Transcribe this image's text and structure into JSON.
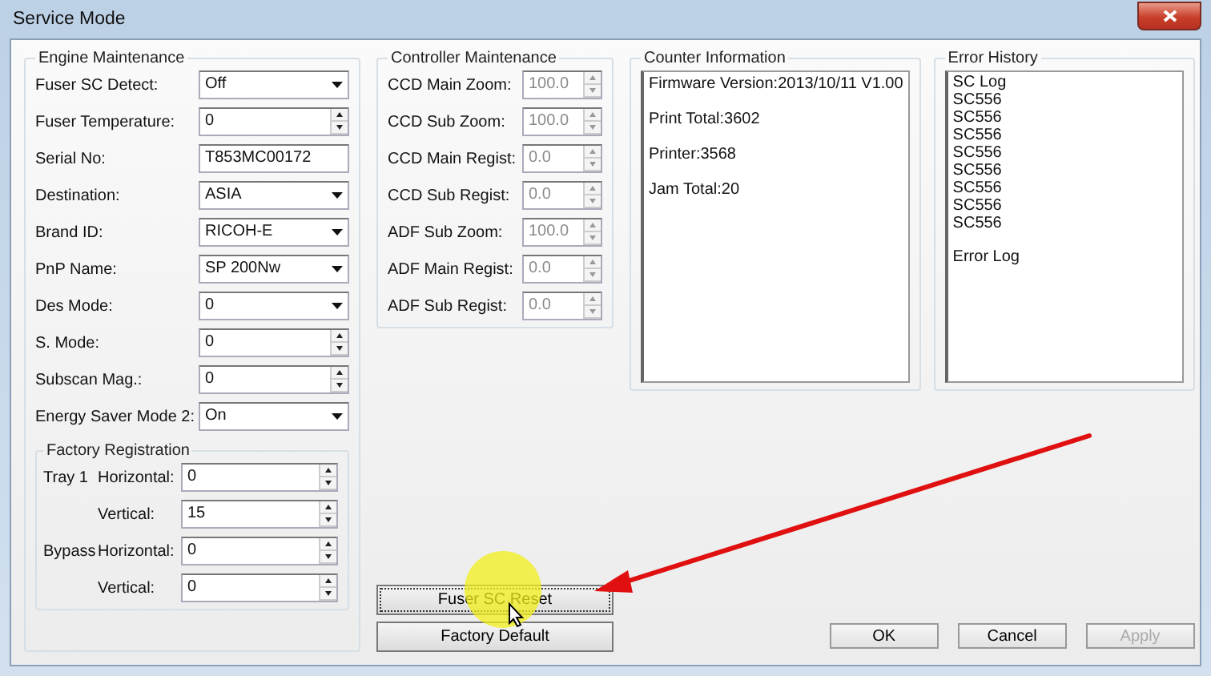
{
  "window": {
    "title": "Service Mode"
  },
  "engine_maintenance": {
    "title": "Engine Maintenance",
    "fields": [
      {
        "label": "Fuser SC Detect:",
        "value": "Off",
        "kind": "dropdown"
      },
      {
        "label": "Fuser Temperature:",
        "value": "0",
        "kind": "spin"
      },
      {
        "label": "Serial No:",
        "value": "T853MC00172",
        "kind": "text"
      },
      {
        "label": "Destination:",
        "value": "ASIA",
        "kind": "dropdown"
      },
      {
        "label": "Brand ID:",
        "value": "RICOH-E",
        "kind": "dropdown"
      },
      {
        "label": "PnP Name:",
        "value": "SP 200Nw",
        "kind": "dropdown"
      },
      {
        "label": "Des Mode:",
        "value": "0",
        "kind": "dropdown"
      },
      {
        "label": "S. Mode:",
        "value": "0",
        "kind": "spin"
      },
      {
        "label": "Subscan Mag.:",
        "value": "0",
        "kind": "spin"
      },
      {
        "label": "Energy Saver Mode 2:",
        "value": "On",
        "kind": "dropdown"
      }
    ]
  },
  "factory_registration": {
    "title": "Factory Registration",
    "rows": [
      {
        "group": "Tray 1",
        "label": "Horizontal:",
        "value": "0"
      },
      {
        "label": "Vertical:",
        "value": "15"
      },
      {
        "group": "Bypass",
        "label": "Horizontal:",
        "value": "0"
      },
      {
        "label": "Vertical:",
        "value": "0"
      }
    ]
  },
  "controller_maintenance": {
    "title": "Controller Maintenance",
    "fields": [
      {
        "label": "CCD Main Zoom:",
        "value": "100.0",
        "disabled": true
      },
      {
        "label": "CCD Sub Zoom:",
        "value": "100.0",
        "disabled": true
      },
      {
        "label": "CCD Main Regist:",
        "value": "0.0",
        "disabled": true
      },
      {
        "label": "CCD Sub Regist:",
        "value": "0.0",
        "disabled": true
      },
      {
        "label": "ADF Sub Zoom:",
        "value": "100.0",
        "disabled": true
      },
      {
        "label": "ADF Main Regist:",
        "value": "0.0",
        "disabled": true
      },
      {
        "label": "ADF Sub Regist:",
        "value": "0.0",
        "disabled": true
      }
    ]
  },
  "counter_information": {
    "title": "Counter Information",
    "lines": [
      "Firmware Version:2013/10/11 V1.00",
      "Print Total:3602",
      "Printer:3568",
      "Jam Total:20"
    ]
  },
  "error_history": {
    "title": "Error History",
    "sections": [
      {
        "lines": [
          "SC Log",
          "SC556",
          "SC556",
          "SC556",
          "SC556",
          "SC556",
          "SC556",
          "SC556",
          "SC556"
        ]
      },
      {
        "lines": [
          "Error Log"
        ]
      }
    ]
  },
  "action_buttons": [
    {
      "label": "Fuser SC Reset",
      "focused": true
    },
    {
      "label": "Factory Default",
      "focused": false
    }
  ],
  "dialog_buttons": [
    {
      "label": "OK",
      "disabled": false
    },
    {
      "label": "Cancel",
      "disabled": false
    },
    {
      "label": "Apply",
      "disabled": true
    }
  ]
}
